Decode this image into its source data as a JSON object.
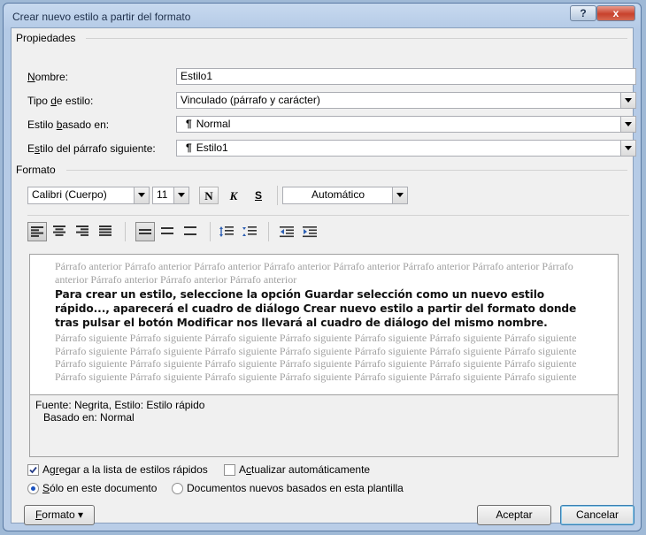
{
  "window": {
    "title": "Crear nuevo estilo a partir del formato",
    "help_label": "?",
    "close_label": "x"
  },
  "properties": {
    "group_title": "Propiedades",
    "name_label_key": "N",
    "name_label_rest": "ombre:",
    "name_value": "Estilo1",
    "type_label_pre": "Tipo ",
    "type_label_key": "d",
    "type_label_post": "e estilo:",
    "type_value": "Vinculado (párrafo y carácter)",
    "based_label_pre": "Estilo ",
    "based_label_key": "b",
    "based_label_post": "asado en:",
    "based_value": "Normal",
    "next_label_pre": "E",
    "next_label_key": "s",
    "next_label_post": "tilo del párrafo siguiente:",
    "next_value": "Estilo1",
    "pilcrow": "¶"
  },
  "format": {
    "group_title": "Formato",
    "font": "Calibri (Cuerpo)",
    "size": "11",
    "bold_label": "N",
    "italic_label": "K",
    "underline_label": "S",
    "color": "Automático"
  },
  "preview": {
    "previous_text": "Párrafo anterior Párrafo anterior Párrafo anterior Párrafo anterior Párrafo anterior Párrafo anterior Párrafo anterior Párrafo anterior Párrafo anterior Párrafo anterior Párrafo anterior",
    "sample_text": "Para crear un estilo, seleccione la opción Guardar selección como un nuevo estilo rápido..., aparecerá el cuadro de diálogo Crear nuevo estilo a partir del formato donde tras pulsar el botón Modificar nos llevará al cuadro de diálogo del mismo nombre.",
    "following_text": "Párrafo siguiente Párrafo siguiente Párrafo siguiente Párrafo siguiente Párrafo siguiente Párrafo siguiente Párrafo siguiente Párrafo siguiente Párrafo siguiente Párrafo siguiente Párrafo siguiente Párrafo siguiente Párrafo siguiente Párrafo siguiente Párrafo siguiente Párrafo siguiente Párrafo siguiente Párrafo siguiente Párrafo siguiente Párrafo siguiente Párrafo siguiente Párrafo siguiente Párrafo siguiente Párrafo siguiente Párrafo siguiente Párrafo siguiente Párrafo siguiente Párrafo siguiente"
  },
  "description": {
    "line1": "Fuente: Negrita, Estilo: Estilo rápido",
    "line2": "Basado en: Normal"
  },
  "options": {
    "add_quick_pre": "Ag",
    "add_quick_key": "r",
    "add_quick_post": "egar a la lista de estilos rápidos",
    "add_quick_checked": true,
    "auto_update_pre": "A",
    "auto_update_key": "c",
    "auto_update_post": "tualizar automáticamente",
    "auto_update_checked": false,
    "this_doc_key": "S",
    "this_doc_post": "ólo en este documento",
    "new_docs_label": "Documentos nuevos basados en esta plantilla"
  },
  "buttons": {
    "format_key": "F",
    "format_post": "ormato",
    "format_arrow": "▾",
    "accept": "Aceptar",
    "cancel": "Cancelar"
  },
  "colors": {
    "titlebar": "#b9cde7",
    "close_button": "#c8412c",
    "dialog_bg": "#f0f0f0",
    "radio_dot": "#1a52c0"
  }
}
